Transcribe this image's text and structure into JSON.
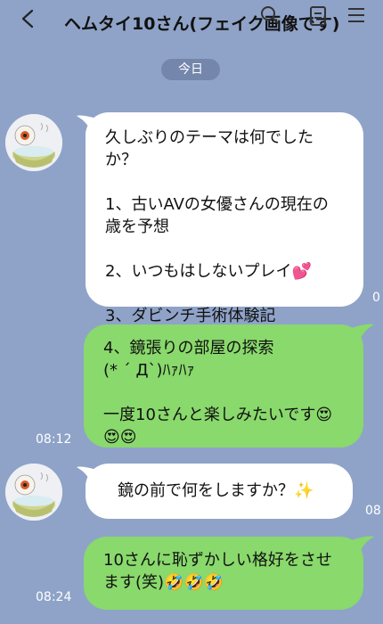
{
  "header": {
    "title": "ヘムタイ10さん(フェイク画像です)"
  },
  "date_label": "今日",
  "messages": [
    {
      "text": "久しぶりのテーマは何でしたか？\n\n1、古いAVの女優さんの現在の歳を予想\n\n2、いつもはしないプレイ💕\n\n3、ダビンチ手術体験記",
      "time": "0"
    },
    {
      "text": "4、鏡張りの部屋の探索\n(* ´ Д`)ﾊｧﾊｧ\n\n一度10さんと楽しみたいです😍😍😍",
      "time": "08:12"
    },
    {
      "text": "鏡の前で何をしますか？✨",
      "time": "08"
    },
    {
      "text": "10さんに恥ずかしい格好をさせます(笑)🤣🤣🤣",
      "time": "08:24"
    }
  ],
  "colors": {
    "background": "#8fa3c8",
    "incoming_bubble": "#ffffff",
    "outgoing_bubble": "#89d96c",
    "date_pill": "#7486ab"
  },
  "icons": [
    "back-icon",
    "search-icon",
    "notes-icon",
    "menu-icon",
    "avatar"
  ]
}
